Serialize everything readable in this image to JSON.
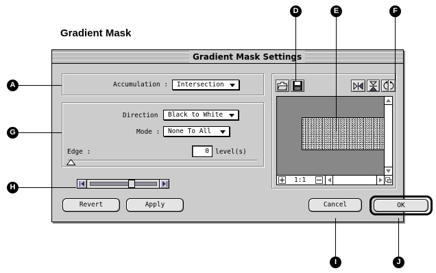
{
  "page_heading": "Gradient Mask",
  "window": {
    "title": "Gradient Mask Settings"
  },
  "accumulation": {
    "label": "Accumulation :",
    "value": "Intersection"
  },
  "direction": {
    "label": "Direction :",
    "value": "Black to White"
  },
  "mode": {
    "label": "Mode :",
    "value": "None To All"
  },
  "edge": {
    "label": "Edge :",
    "value": "0",
    "unit": "level(s)"
  },
  "buttons": {
    "revert": "Revert",
    "apply": "Apply",
    "cancel": "Cancel",
    "ok": "OK"
  },
  "preview": {
    "zoom_label": "1:1"
  },
  "callouts": {
    "a": "A",
    "d": "D",
    "e": "E",
    "f": "F",
    "g": "G",
    "h": "H",
    "i": "I",
    "j": "J"
  },
  "icons": [
    "open-folder-icon",
    "save-disk-icon",
    "flip-horizontal-icon",
    "flip-vertical-icon",
    "rotate-left-icon",
    "rotate-right-icon",
    "zoom-in-icon",
    "zoom-out-icon",
    "scroll-up-icon",
    "scroll-down-icon",
    "scroll-left-icon",
    "scroll-right-icon",
    "slider-left-icon",
    "slider-right-icon",
    "edge-marker-icon",
    "resize-corner-icon"
  ],
  "colors": {
    "window_bg": "#cccccc",
    "callout": "#000000",
    "preview_bg": "#888888"
  }
}
